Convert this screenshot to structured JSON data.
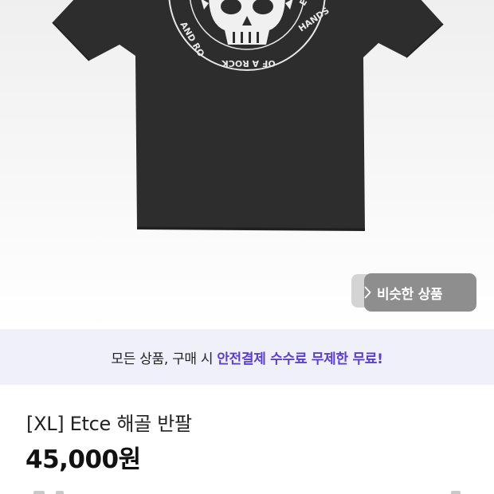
{
  "product_image": {
    "description_icon": "skull-tshirt-image",
    "print_text": "E IN THE HANDS OF A ROCK AND RO"
  },
  "similar_button": {
    "label": "비슷한 상품",
    "icon": "chevron-right-icon"
  },
  "promo": {
    "normal_text": "모든 상품, 구매 시",
    "highlight_text": "안전결제 수수료 무제한 무료!",
    "highlight_color": "#5b3fc9"
  },
  "product": {
    "title": "[XL] Etce 해골 반팔",
    "price": "45,000원"
  }
}
